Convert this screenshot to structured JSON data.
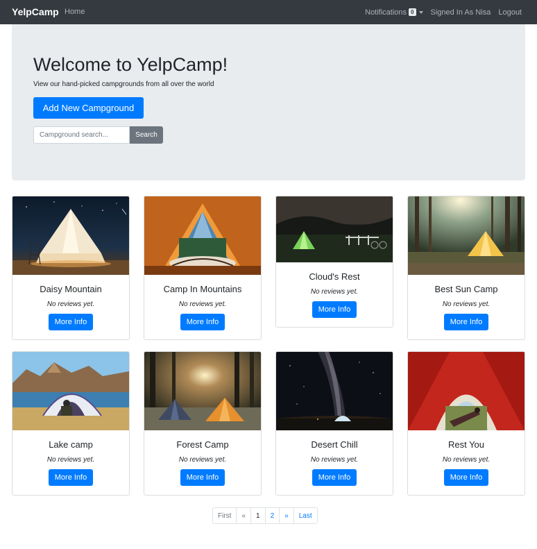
{
  "navbar": {
    "brand": "YelpCamp",
    "home": "Home",
    "notifications": "Notifications",
    "notification_count": "0",
    "signed_in": "Signed In As Nisa",
    "logout": "Logout"
  },
  "jumbotron": {
    "title": "Welcome to YelpCamp!",
    "subtitle": "View our hand-picked campgrounds from all over the world",
    "add_button": "Add New Campground",
    "search_placeholder": "Campground search...",
    "search_button": "Search"
  },
  "campgrounds": [
    {
      "name": "Daisy Mountain",
      "reviews": "No reviews yet.",
      "button": "More Info"
    },
    {
      "name": "Camp In Mountains",
      "reviews": "No reviews yet.",
      "button": "More Info"
    },
    {
      "name": "Cloud's Rest",
      "reviews": "No reviews yet.",
      "button": "More Info"
    },
    {
      "name": "Best Sun Camp",
      "reviews": "No reviews yet.",
      "button": "More Info"
    },
    {
      "name": "Lake camp",
      "reviews": "No reviews yet.",
      "button": "More Info"
    },
    {
      "name": "Forest Camp",
      "reviews": "No reviews yet.",
      "button": "More Info"
    },
    {
      "name": "Desert Chill",
      "reviews": "No reviews yet.",
      "button": "More Info"
    },
    {
      "name": "Rest You",
      "reviews": "No reviews yet.",
      "button": "More Info"
    }
  ],
  "pagination": {
    "first": "First",
    "prev": "«",
    "page1": "1",
    "page2": "2",
    "next": "»",
    "last": "Last"
  },
  "colors": {
    "primary": "#007bff",
    "navbar": "#343a40",
    "jumbotron": "#e9ecef",
    "secondary": "#6c757d"
  }
}
